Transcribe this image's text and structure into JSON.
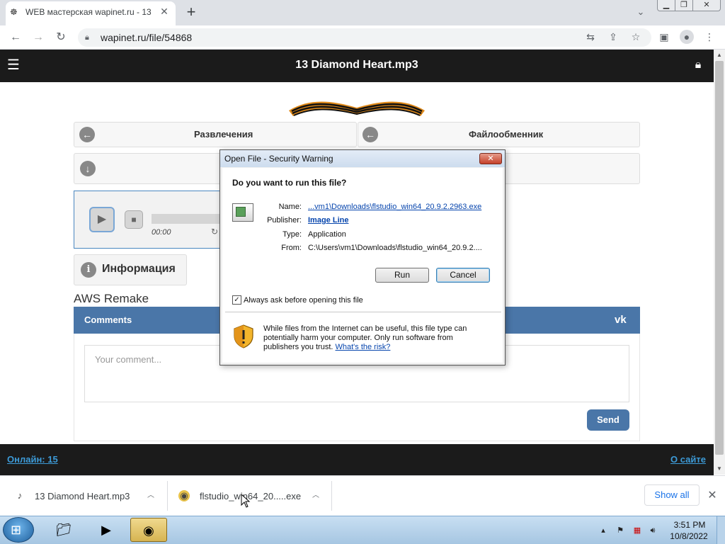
{
  "browser": {
    "tab_title": "WEB мастерская wapinet.ru - 13",
    "tab_close": "✕",
    "new_tab": "+",
    "url": "wapinet.ru/file/54868",
    "icons": [
      "favicon-icon",
      "back-icon",
      "forward-icon",
      "reload-icon",
      "lock-icon",
      "translate-icon",
      "share-icon",
      "star-icon",
      "sidepanel-icon",
      "profile-icon",
      "menu-dots-icon"
    ]
  },
  "site": {
    "page_title": "13 Diamond Heart.mp3",
    "nav": {
      "entertainment": "Развлечения",
      "file_exchange": "Файлообменник"
    },
    "player": {
      "time": "00:00"
    },
    "info_tab": "Информация",
    "song_title": "AWS Remake",
    "comments": {
      "title": "Comments",
      "vk": "VK",
      "placeholder": "Your comment...",
      "send": "Send"
    },
    "footer": {
      "online": "Онлайн: 15",
      "about": "О сайте"
    }
  },
  "dialog": {
    "title": "Open File - Security Warning",
    "close": "✕",
    "question": "Do you want to run this file?",
    "fields": {
      "name_label": "Name:",
      "name_value": "...vm1\\Downloads\\flstudio_win64_20.9.2.2963.exe",
      "publisher_label": "Publisher:",
      "publisher_value": "Image Line",
      "type_label": "Type:",
      "type_value": "Application",
      "from_label": "From:",
      "from_value": "C:\\Users\\vm1\\Downloads\\flstudio_win64_20.9.2...."
    },
    "run": "Run",
    "cancel": "Cancel",
    "always_ask": "Always ask before opening this file",
    "always_ask_checked": true,
    "warning_text": "While files from the Internet can be useful, this file type can potentially harm your computer. Only run software from publishers you trust.",
    "risk_link": "What's the risk?"
  },
  "downloads": {
    "items": [
      {
        "name": "13 Diamond Heart.mp3"
      },
      {
        "name": "flstudio_win64_20.....exe"
      }
    ],
    "show_all": "Show all"
  },
  "taskbar": {
    "time": "3:51 PM",
    "date": "10/8/2022"
  }
}
